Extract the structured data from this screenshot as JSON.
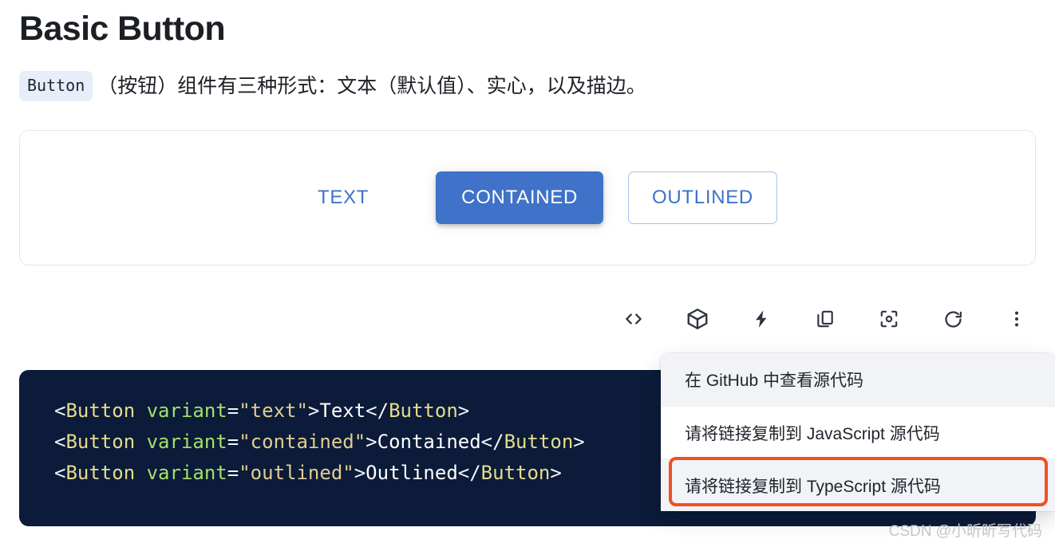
{
  "page": {
    "title": "Basic Button",
    "description": {
      "code_badge": "Button",
      "text": "（按钮）组件有三种形式：文本（默认值）、实心，以及描边。"
    }
  },
  "demo": {
    "buttons": [
      {
        "label": "TEXT",
        "variant": "text"
      },
      {
        "label": "CONTAINED",
        "variant": "contained"
      },
      {
        "label": "OUTLINED",
        "variant": "outlined"
      }
    ],
    "accent_color": "#3f72c8"
  },
  "toolbar": {
    "items": [
      {
        "icon": "code-brackets-icon",
        "name": "show-code"
      },
      {
        "icon": "cube-icon",
        "name": "open-canvas"
      },
      {
        "icon": "lightning-bolt-icon",
        "name": "interactions"
      },
      {
        "icon": "copy-icon",
        "name": "copy"
      },
      {
        "icon": "focus-frame-icon",
        "name": "zoom-focus"
      },
      {
        "icon": "refresh-icon",
        "name": "reload"
      },
      {
        "icon": "more-vertical-icon",
        "name": "more-options"
      }
    ]
  },
  "code": {
    "background": "#0b1b39",
    "lines": [
      [
        {
          "t": "<",
          "c": "punct"
        },
        {
          "t": "Button",
          "c": "tag"
        },
        {
          "t": " ",
          "c": "punct"
        },
        {
          "t": "variant",
          "c": "attr"
        },
        {
          "t": "=",
          "c": "punct"
        },
        {
          "t": "\"text\"",
          "c": "str"
        },
        {
          "t": ">",
          "c": "punct"
        },
        {
          "t": "Text",
          "c": "txt"
        },
        {
          "t": "</",
          "c": "punct"
        },
        {
          "t": "Button",
          "c": "tag"
        },
        {
          "t": ">",
          "c": "punct"
        }
      ],
      [
        {
          "t": "<",
          "c": "punct"
        },
        {
          "t": "Button",
          "c": "tag"
        },
        {
          "t": " ",
          "c": "punct"
        },
        {
          "t": "variant",
          "c": "attr"
        },
        {
          "t": "=",
          "c": "punct"
        },
        {
          "t": "\"contained\"",
          "c": "str"
        },
        {
          "t": ">",
          "c": "punct"
        },
        {
          "t": "Contained",
          "c": "txt"
        },
        {
          "t": "</",
          "c": "punct"
        },
        {
          "t": "Button",
          "c": "tag"
        },
        {
          "t": ">",
          "c": "punct"
        }
      ],
      [
        {
          "t": "<",
          "c": "punct"
        },
        {
          "t": "Button",
          "c": "tag"
        },
        {
          "t": " ",
          "c": "punct"
        },
        {
          "t": "variant",
          "c": "attr"
        },
        {
          "t": "=",
          "c": "punct"
        },
        {
          "t": "\"outlined\"",
          "c": "str"
        },
        {
          "t": ">",
          "c": "punct"
        },
        {
          "t": "Outlined",
          "c": "txt"
        },
        {
          "t": "</",
          "c": "punct"
        },
        {
          "t": "Button",
          "c": "tag"
        },
        {
          "t": ">",
          "c": "punct"
        }
      ]
    ]
  },
  "menu": {
    "items": [
      {
        "label": "在 GitHub 中查看源代码",
        "hovered": true
      },
      {
        "label": "请将链接复制到 JavaScript 源代码",
        "hovered": false
      },
      {
        "label": "请将链接复制到 TypeScript 源代码",
        "hovered": true
      }
    ]
  },
  "annotation": {
    "color": "#ef4f24",
    "target": "请将链接复制到 TypeScript 源代码"
  },
  "watermark": {
    "text": "CSDN @小昕昕写代码"
  }
}
